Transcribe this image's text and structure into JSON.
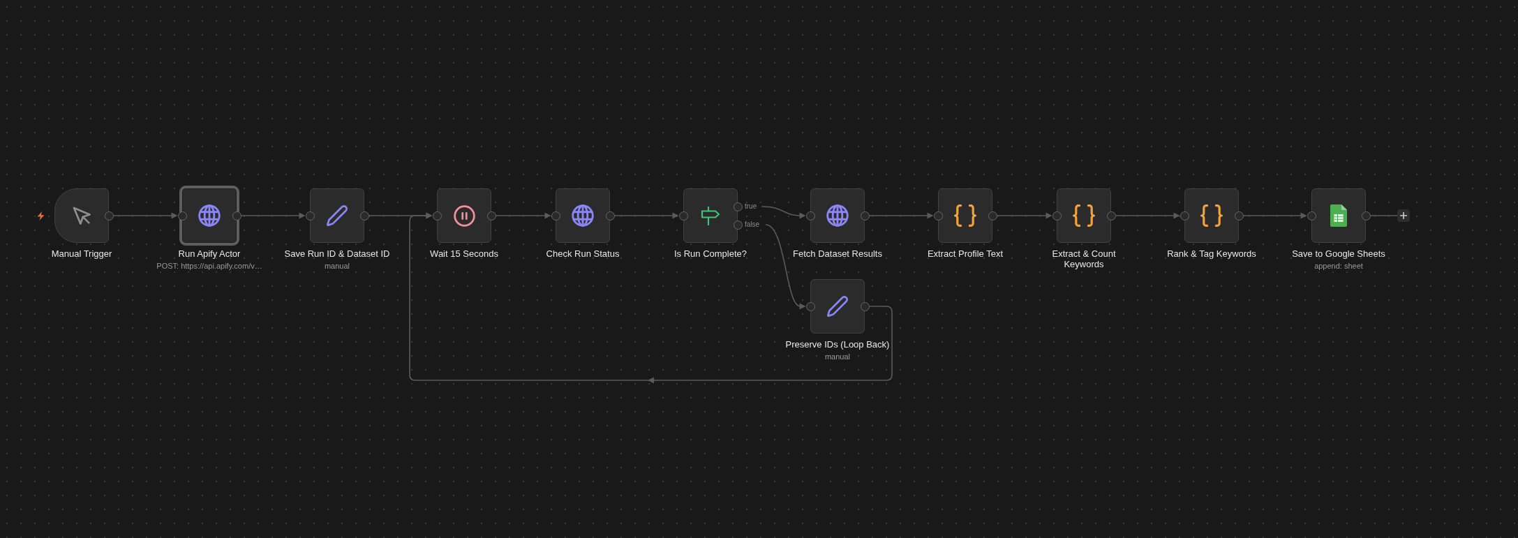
{
  "canvas": {
    "nodes": [
      {
        "kind": "trigger",
        "title": "Manual Trigger",
        "selected": false
      },
      {
        "kind": "http",
        "title": "Run Apify Actor",
        "subtitle": "POST: https://api.apify.com/v…",
        "selected": true
      },
      {
        "kind": "set",
        "title": "Save Run ID & Dataset ID",
        "subtitle": "manual",
        "selected": false
      },
      {
        "kind": "wait",
        "title": "Wait 15 Seconds",
        "selected": false
      },
      {
        "kind": "http",
        "title": "Check Run Status",
        "selected": false
      },
      {
        "kind": "if",
        "title": "Is Run Complete?",
        "selected": false,
        "outputs": [
          {
            "label": "true"
          },
          {
            "label": "false",
            "node": {
              "kind": "set",
              "title": "Preserve IDs (Loop Back)",
              "subtitle": "manual",
              "selected": false
            }
          }
        ]
      },
      {
        "kind": "http",
        "title": "Fetch Dataset Results",
        "selected": false
      },
      {
        "kind": "code",
        "title": "Extract Profile Text",
        "selected": false
      },
      {
        "kind": "code",
        "title": "Extract & Count\nKeywords",
        "selected": false
      },
      {
        "kind": "code",
        "title": "Rank & Tag Keywords",
        "selected": false
      },
      {
        "kind": "sheets",
        "title": "Save to Google Sheets",
        "subtitle": "append: sheet",
        "selected": false
      }
    ]
  }
}
